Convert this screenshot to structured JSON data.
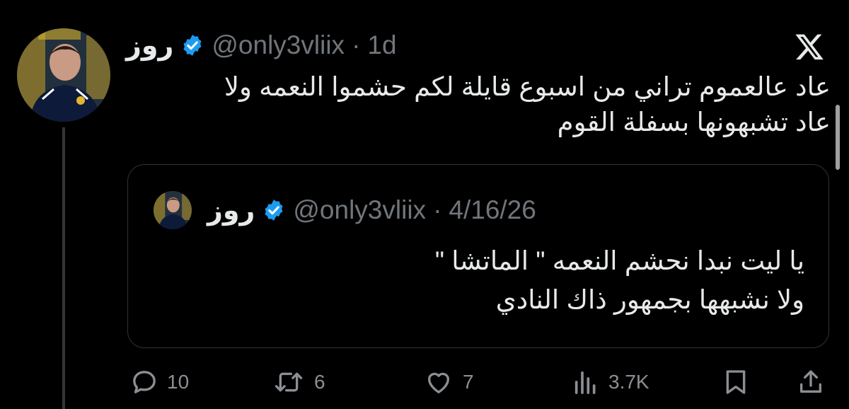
{
  "tweet": {
    "author": {
      "display_name": "روز",
      "handle": "@only3vliix",
      "verified_icon": "verified-badge-icon"
    },
    "separator": "·",
    "timestamp": "1d",
    "text_lines": [
      "عاد عالعموم تراني من اسبوع قايلة لكم حشموا النعمه ولا",
      "عاد تشبهونها بسفلة القوم"
    ]
  },
  "brand_icon": "x-logo-icon",
  "quoted_tweet": {
    "author": {
      "display_name": "روز",
      "handle": "@only3vliix"
    },
    "separator": "·",
    "timestamp": "4/16/26",
    "text_lines": [
      "يا ليت نبدا نحشم النعمه \" الماتشا \"",
      "ولا نشبهها بجمهور ذاك النادي"
    ]
  },
  "actions": {
    "replies": {
      "icon": "reply-icon",
      "count": "10"
    },
    "retweets": {
      "icon": "retweet-icon",
      "count": "6"
    },
    "likes": {
      "icon": "heart-icon",
      "count": "7"
    },
    "views": {
      "icon": "views-icon",
      "count": "3.7K"
    },
    "bookmark": {
      "icon": "bookmark-icon"
    },
    "share": {
      "icon": "share-icon"
    }
  },
  "colors": {
    "background": "#000000",
    "text": "#e7e9ea",
    "muted": "#71767b",
    "verified": "#1d9bf0",
    "border": "#2f3336"
  }
}
